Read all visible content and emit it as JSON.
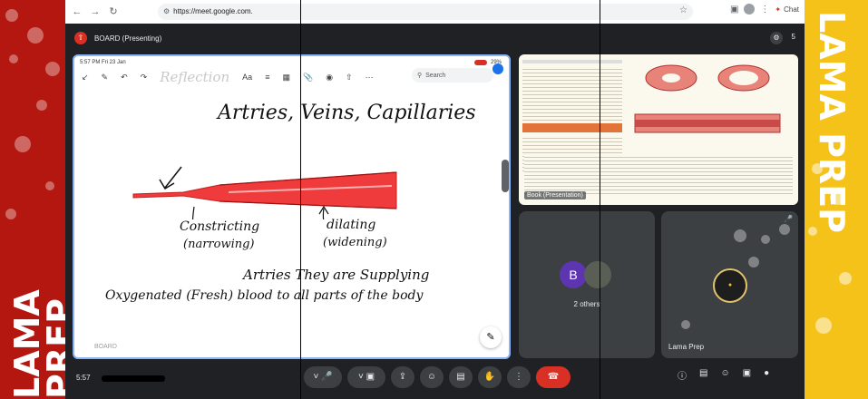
{
  "browser": {
    "url": "https://meet.google.com.",
    "chat_label": "Chat"
  },
  "meet": {
    "presenting_label": "BOARD (Presenting)"
  },
  "board": {
    "status_time": "5:57 PM  Fri 23 Jan",
    "battery": "29%",
    "search_placeholder": "Search",
    "title_faint": "Reflection",
    "notes": {
      "line1": "Artries, Veins, Capillaries",
      "label_left": "Constricting",
      "label_left_sub": "(narrowing)",
      "label_right": "dilating",
      "label_right_sub": "(widening)",
      "line_bottom1": "Artries They are Supplying",
      "line_bottom2": "Oxygenated (Fresh) blood to all parts of the body"
    },
    "tile_label": "BOARD"
  },
  "book": {
    "label": "Book (Presentation)"
  },
  "participants": {
    "others_avatar_initial": "B",
    "others_label": "2 others",
    "host_label": "Lama Prep"
  },
  "controls": {
    "time": "5:57"
  },
  "brand": {
    "text": "LAMA PREP"
  }
}
